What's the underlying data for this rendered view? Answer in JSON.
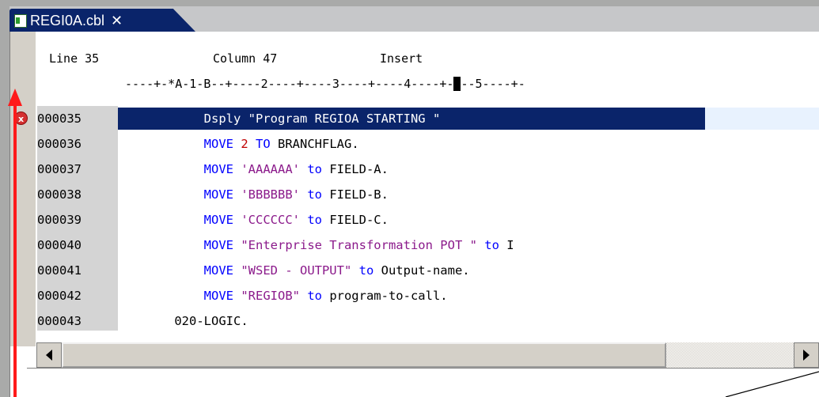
{
  "tab": {
    "label": "REGI0A.cbl",
    "close_glyph": "✕"
  },
  "status": {
    "line": "Line 35",
    "column": "Column 47",
    "mode": "Insert"
  },
  "ruler": {
    "before_cursor": "----+-*A-1-B--+----2----+----3----+----4----+-",
    "cursor": "-",
    "after_cursor": "--5----+-"
  },
  "lines": [
    {
      "seq": "000035",
      "parts": [
        {
          "t": "Dsply \"Program REGIOA STARTING \"",
          "c": "plain"
        }
      ],
      "selected": true,
      "indent": "           "
    },
    {
      "seq": "000036",
      "parts": [
        {
          "t": "MOVE ",
          "c": "kw"
        },
        {
          "t": "2",
          "c": "num"
        },
        {
          "t": " TO ",
          "c": "kw"
        },
        {
          "t": "BRANCHFLAG.",
          "c": "plain"
        }
      ],
      "indent": "           "
    },
    {
      "seq": "000037",
      "parts": [
        {
          "t": "MOVE ",
          "c": "kw"
        },
        {
          "t": "'AAAAAA'",
          "c": "str2"
        },
        {
          "t": " to ",
          "c": "kw"
        },
        {
          "t": "FIELD-A.",
          "c": "plain"
        }
      ],
      "indent": "           "
    },
    {
      "seq": "000038",
      "parts": [
        {
          "t": "MOVE ",
          "c": "kw"
        },
        {
          "t": "'BBBBBB'",
          "c": "str2"
        },
        {
          "t": " to ",
          "c": "kw"
        },
        {
          "t": "FIELD-B.",
          "c": "plain"
        }
      ],
      "indent": "           "
    },
    {
      "seq": "000039",
      "parts": [
        {
          "t": "MOVE ",
          "c": "kw"
        },
        {
          "t": "'CCCCCC'",
          "c": "str2"
        },
        {
          "t": " to ",
          "c": "kw"
        },
        {
          "t": "FIELD-C.",
          "c": "plain"
        }
      ],
      "indent": "           "
    },
    {
      "seq": "000040",
      "parts": [
        {
          "t": "MOVE ",
          "c": "kw"
        },
        {
          "t": "\"Enterprise Transformation POT \"",
          "c": "str2"
        },
        {
          "t": " to ",
          "c": "kw"
        },
        {
          "t": "I",
          "c": "plain"
        }
      ],
      "indent": "           "
    },
    {
      "seq": "000041",
      "parts": [
        {
          "t": "MOVE ",
          "c": "kw"
        },
        {
          "t": "\"WSED - OUTPUT\"",
          "c": "str2"
        },
        {
          "t": " to ",
          "c": "kw"
        },
        {
          "t": "Output-name.",
          "c": "plain"
        }
      ],
      "indent": "           "
    },
    {
      "seq": "000042",
      "parts": [
        {
          "t": "MOVE ",
          "c": "kw"
        },
        {
          "t": "\"REGIOB\"",
          "c": "str2"
        },
        {
          "t": " to ",
          "c": "kw"
        },
        {
          "t": "program-to-call.",
          "c": "plain"
        }
      ],
      "indent": "           "
    },
    {
      "seq": "000043",
      "parts": [
        {
          "t": "020-LOGIC.",
          "c": "plain"
        }
      ],
      "indent": "       "
    }
  ],
  "error_marker": {
    "icon": "error-x-icon",
    "glyph": "x",
    "color": "#d43030"
  },
  "colors": {
    "selection": "#0a246a",
    "keyword": "#0000ff",
    "string": "#8b1a8b",
    "number": "#c00000",
    "annotation_arrow": "#ff1a1a"
  }
}
